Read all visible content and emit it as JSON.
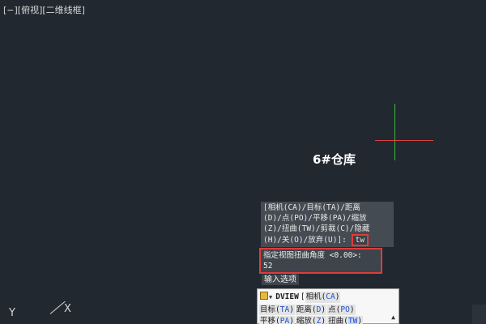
{
  "viewport": {
    "label": "[−][俯视][二维线框]",
    "text_label": "6#仓库"
  },
  "command_history": {
    "lines": [
      "[相机(CA)/目标(TA)/距离",
      "(D)/点(PO)/平移(PA)/缩放",
      "(Z)/扭曲(TW)/剪裁(C)/隐藏",
      "(H)/关(O)/放弃(U)]:"
    ],
    "typed_input": "tw"
  },
  "angle_prompt": {
    "line1": "指定视图扭曲角度 <0.00>:",
    "line2": "52"
  },
  "options_label": "输入选项",
  "command_input": {
    "icon": "command-icon",
    "command": "DVIEW",
    "bracket": "[",
    "row1_opt": {
      "text": "相机(",
      "key": "CA",
      "close": ")"
    },
    "row2": [
      {
        "text": "目标(",
        "key": "TA",
        "close": ")"
      },
      {
        "text": "距离(",
        "key": "D",
        "close": ")"
      },
      {
        "text": "点(",
        "key": "PO",
        "close": ")"
      }
    ],
    "row3": [
      {
        "text": "平移(",
        "key": "PA",
        "close": ")"
      },
      {
        "text": "缩放(",
        "key": "Z",
        "close": ")"
      },
      {
        "text": "扭曲(",
        "key": "TW",
        "close": ")"
      }
    ]
  },
  "ucs": {
    "y": "Y",
    "x": "X"
  },
  "colors": {
    "background": "#212830",
    "crosshair_vertical": "#3fb93f",
    "crosshair_horizontal": "#d94444",
    "highlight_box": "#e03b3b",
    "option_key": "#1f50c8"
  }
}
